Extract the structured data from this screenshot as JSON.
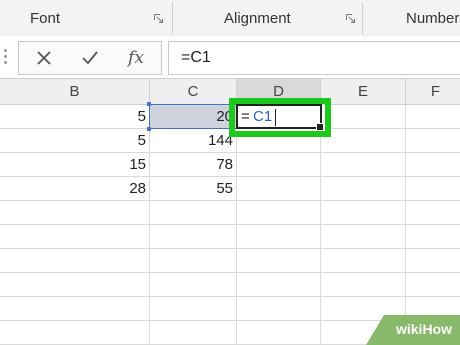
{
  "ribbon": {
    "groups": [
      {
        "label": "Font"
      },
      {
        "label": "Alignment"
      },
      {
        "label": "Number"
      }
    ]
  },
  "formula_bar": {
    "content": "=C1",
    "fx_label": "fx"
  },
  "columns": [
    "B",
    "C",
    "D",
    "E",
    "F"
  ],
  "rows": [
    {
      "B": "5",
      "C": "20"
    },
    {
      "B": "5",
      "C": "144"
    },
    {
      "B": "15",
      "C": "78"
    },
    {
      "B": "28",
      "C": "55"
    }
  ],
  "active_cell": {
    "eq": "=",
    "ref": "C1"
  },
  "colors": {
    "highlight_frame": "#1cc91c",
    "reference": "#2c62c7"
  },
  "watermark": {
    "text": "wikiHow"
  }
}
